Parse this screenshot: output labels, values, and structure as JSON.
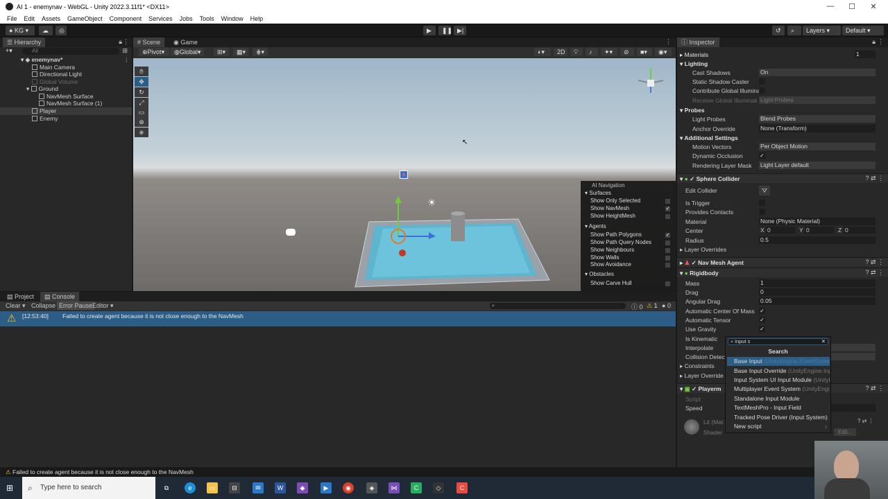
{
  "window": {
    "title": "AI 1 - enemynav - WebGL - Unity 2022.3.11f1* <DX11>"
  },
  "menu": [
    "File",
    "Edit",
    "Assets",
    "GameObject",
    "Component",
    "Services",
    "Jobs",
    "Tools",
    "Window",
    "Help"
  ],
  "toolbar": {
    "account": "KG",
    "layers": "Layers",
    "layout": "Default"
  },
  "hierarchy": {
    "tab": "Hierarchy",
    "search_placeholder": "All",
    "scene": "enemynav*",
    "items": [
      "Main Camera",
      "Directional Light",
      "Global Volume",
      "Ground",
      "NavMesh Surface",
      "NavMesh Surface (1)",
      "Player",
      "Enemy"
    ]
  },
  "scene": {
    "tabs": [
      "Scene",
      "Game"
    ],
    "pivot": "Pivot",
    "global": "Global",
    "mode_2d": "2D",
    "nav_overlay": {
      "title": "AI Navigation",
      "surfaces": "Surfaces",
      "surface_items": [
        "Show Only Selected",
        "Show NavMesh",
        "Show HeightMesh"
      ],
      "agents": "Agents",
      "agent_items": [
        "Show Path Polygons",
        "Show Path Query Nodes",
        "Show Neighbours",
        "Show Walls",
        "Show Avoidance"
      ],
      "obstacles": "Obstacles",
      "obstacle_items": [
        "Show Carve Hull"
      ]
    }
  },
  "console": {
    "tabs": [
      "Project",
      "Console"
    ],
    "buttons": [
      "Clear",
      "Collapse",
      "Error Pause",
      "Editor"
    ],
    "counts": [
      "0",
      "1",
      "0"
    ],
    "log_time": "[12:53:40]",
    "log_message": "Failed to create agent because it is not close enough to the NavMesh"
  },
  "inspector": {
    "tab": "Inspector",
    "materials_label": "Materials",
    "materials_count": "1",
    "lighting": "Lighting",
    "cast_shadows": {
      "label": "Cast Shadows",
      "value": "On"
    },
    "static_shadow": "Static Shadow Caster",
    "contrib_gi": "Contribute Global Illumina",
    "receive_gi": {
      "label": "Receive Global Illuminati",
      "value": "Light Probes"
    },
    "probes": "Probes",
    "light_probes": {
      "label": "Light Probes",
      "value": "Blend Probes"
    },
    "anchor_override": {
      "label": "Anchor Override",
      "value": "None (Transform)"
    },
    "additional": "Additional Settings",
    "motion_vectors": {
      "label": "Motion Vectors",
      "value": "Per Object Motion"
    },
    "dynamic_occlusion": "Dynamic Occlusion",
    "rendering_layer": {
      "label": "Rendering Layer Mask",
      "value": "Light Layer default"
    },
    "sphere_collider": "Sphere Collider",
    "edit_collider": "Edit Collider",
    "is_trigger": "Is Trigger",
    "provides_contacts": "Provides Contacts",
    "material": {
      "label": "Material",
      "value": "None (Physic Material)"
    },
    "center": {
      "label": "Center",
      "x": "0",
      "y": "0",
      "z": "0"
    },
    "radius": {
      "label": "Radius",
      "value": "0.5"
    },
    "layer_overrides": "Layer Overrides",
    "nav_mesh_agent": "Nav Mesh Agent",
    "rigidbody": "Rigidbody",
    "mass": {
      "label": "Mass",
      "value": "1"
    },
    "drag": {
      "label": "Drag",
      "value": "0"
    },
    "angular_drag": {
      "label": "Angular Drag",
      "value": "0.05"
    },
    "auto_com": "Automatic Center Of Mass",
    "auto_tensor": "Automatic Tensor",
    "use_gravity": "Use Gravity",
    "is_kinematic": "Is Kinematic",
    "interpolate": "Interpolate",
    "collision_detection": "Collision Detec",
    "constraints": "Constraints",
    "layer_overrides2": "Layer Override",
    "player_script": "Playerm",
    "script": "Script",
    "speed": "Speed",
    "lit_material": "Lit (Mat",
    "shader": "Shader",
    "edit": "Edit..."
  },
  "popup": {
    "query": "input s",
    "title": "Search",
    "items": [
      {
        "name": "Base Input",
        "sub": "(UnityEngine.EventSystems)"
      },
      {
        "name": "Base Input Override",
        "sub": "(UnityEngine.Input"
      },
      {
        "name": "Input System UI Input Module",
        "sub": "(UnityE"
      },
      {
        "name": "Multiplayer Event System",
        "sub": "(UnityEngin"
      },
      {
        "name": "Standalone Input Module",
        "sub": ""
      },
      {
        "name": "TextMeshPro - Input Field",
        "sub": ""
      },
      {
        "name": "Tracked Pose Driver (Input System)",
        "sub": ""
      },
      {
        "name": "New script",
        "sub": ""
      }
    ]
  },
  "statusbar": {
    "message": "Failed to create agent because it is not close enough to the NavMesh"
  },
  "taskbar": {
    "search_placeholder": "Type here to search"
  }
}
